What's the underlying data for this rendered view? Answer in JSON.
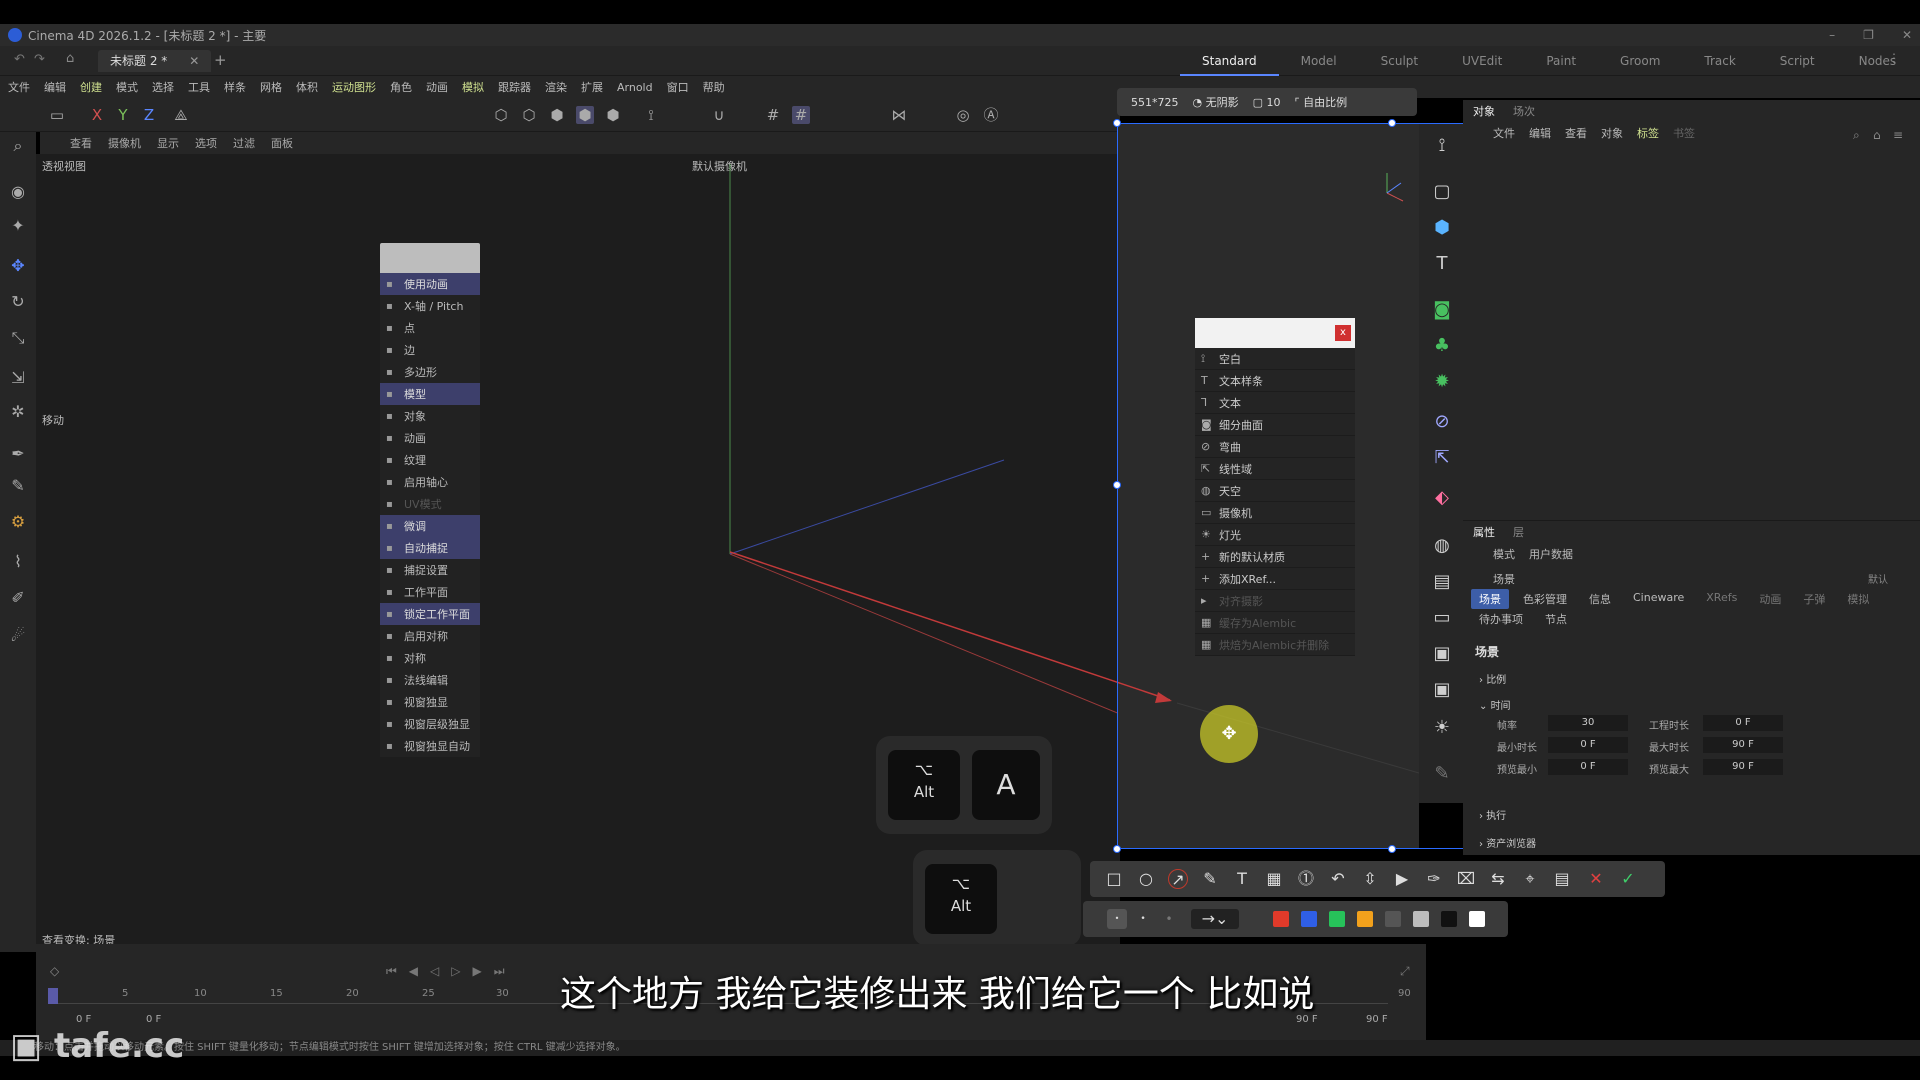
{
  "window": {
    "title": "Cinema 4D 2026.1.2 - [未标题 2 *] - 主要",
    "doc_tab": "未标题 2 *",
    "controls": [
      "–",
      "❐",
      "✕"
    ]
  },
  "layouts": [
    "Standard",
    "Model",
    "Sculpt",
    "UVEdit",
    "Paint",
    "Groom",
    "Track",
    "Script",
    "Nodes"
  ],
  "menu": [
    "文件",
    "编辑",
    "创建",
    "模式",
    "选择",
    "工具",
    "样条",
    "网格",
    "体积",
    "运动图形",
    "角色",
    "动画",
    "模拟",
    "跟踪器",
    "渲染",
    "扩展",
    "Arnold",
    "窗口",
    "帮助"
  ],
  "toolbar": {
    "axes": [
      "X",
      "Y",
      "Z"
    ]
  },
  "view_menu": [
    "查看",
    "摄像机",
    "显示",
    "选项",
    "过滤",
    "面板"
  ],
  "viewport": {
    "name": "透视视图",
    "camera": "默认摄像机",
    "move_label": "移动",
    "status": "查看变换: 场景"
  },
  "context_menu_left": {
    "items": [
      {
        "label": "使用动画",
        "state": "sel"
      },
      {
        "label": "X-轴 / Pitch",
        "state": ""
      },
      {
        "label": "点",
        "state": ""
      },
      {
        "label": "边",
        "state": ""
      },
      {
        "label": "多边形",
        "state": ""
      },
      {
        "label": "模型",
        "state": "sel"
      },
      {
        "label": "对象",
        "state": ""
      },
      {
        "label": "动画",
        "state": ""
      },
      {
        "label": "纹理",
        "state": ""
      },
      {
        "label": "启用轴心",
        "state": ""
      },
      {
        "label": "UV模式",
        "state": "dim"
      },
      {
        "label": "微调",
        "state": "sel"
      },
      {
        "label": "自动捕捉",
        "state": "sel"
      },
      {
        "label": "捕捉设置",
        "state": ""
      },
      {
        "label": "工作平面",
        "state": ""
      },
      {
        "label": "锁定工作平面",
        "state": "sel"
      },
      {
        "label": "启用对称",
        "state": ""
      },
      {
        "label": "对称",
        "state": ""
      },
      {
        "label": "法线编辑",
        "state": ""
      },
      {
        "label": "视窗独显",
        "state": ""
      },
      {
        "label": "视窗层级独显",
        "state": ""
      },
      {
        "label": "视窗独显自动",
        "state": ""
      }
    ]
  },
  "keys": {
    "alt_symbol": "⌥",
    "alt_label": "Alt",
    "a_label": "A"
  },
  "selection_info": {
    "size": "551*725",
    "shadow": "无阴影",
    "radius": "10",
    "ratio": "自由比例"
  },
  "create_menu": {
    "close": "x",
    "items": [
      {
        "label": "空白",
        "icon": "null-icon",
        "state": ""
      },
      {
        "label": "文本样条",
        "icon": "text-icon",
        "state": ""
      },
      {
        "label": "文本",
        "icon": "text3d-icon",
        "state": ""
      },
      {
        "label": "细分曲面",
        "icon": "subdivision-icon",
        "state": ""
      },
      {
        "label": "弯曲",
        "icon": "bend-icon",
        "state": ""
      },
      {
        "label": "线性域",
        "icon": "field-icon",
        "state": ""
      },
      {
        "label": "天空",
        "icon": "sky-icon",
        "state": ""
      },
      {
        "label": "摄像机",
        "icon": "camera-icon",
        "state": ""
      },
      {
        "label": "灯光",
        "icon": "light-icon",
        "state": ""
      },
      {
        "label": "新的默认材质",
        "icon": "plus-icon",
        "state": ""
      },
      {
        "label": "添加XRef...",
        "icon": "plus-icon",
        "state": ""
      },
      {
        "label": "对齐摄影",
        "icon": "align-icon",
        "state": "dim"
      },
      {
        "label": "缓存为Alembic",
        "icon": "alembic-icon",
        "state": "dim"
      },
      {
        "label": "烘焙为Alembic并删除",
        "icon": "alembic-icon",
        "state": "dim"
      }
    ]
  },
  "object_manager": {
    "tabs": [
      "对象",
      "场次"
    ],
    "menu": [
      "文件",
      "编辑",
      "查看",
      "对象",
      "标签",
      "书签"
    ]
  },
  "attribute_manager": {
    "tabs": [
      "属性",
      "层"
    ],
    "menu": [
      "模式",
      "用户数据"
    ],
    "context": "场景",
    "preset": "默认",
    "chips_row1": [
      "场景",
      "色彩管理",
      "信息",
      "Cineware",
      "XRefs",
      "动画",
      "子弹",
      "模拟"
    ],
    "chips_row2": [
      "待办事项",
      "节点"
    ],
    "section_title": "场景",
    "groups": [
      "比例",
      "时间",
      "执行",
      "资产浏览器"
    ],
    "fields": [
      {
        "label": "帧率",
        "value": "30",
        "label2": "工程时长",
        "value2": "0 F"
      },
      {
        "label": "最小时长",
        "value": "0 F",
        "label2": "最大时长",
        "value2": "90 F"
      },
      {
        "label": "预览最小",
        "value": "0 F",
        "label2": "预览最大",
        "value2": "90 F"
      }
    ]
  },
  "annotation": {
    "colors": [
      "#e03a2a",
      "#2f5fe6",
      "#27c25a",
      "#f2a11c",
      "#555555",
      "#bdbdbd",
      "#111111",
      "#ffffff"
    ],
    "cancel": "✕",
    "confirm": "✓"
  },
  "timeline": {
    "ticks": [
      "0",
      "5",
      "10",
      "15",
      "20",
      "25",
      "30",
      "90"
    ],
    "start": "0 F",
    "current": "0 F",
    "end": "90 F",
    "end2": "90 F"
  },
  "status_bar": "移动：点击并拖动以移动元素。按住 SHIFT 键量化移动；节点编辑模式时按住 SHIFT 键增加选择对象；按住 CTRL 键减少选择对象。",
  "subtitle": "这个地方 我给它装修出来 我们给它一个 比如说",
  "watermark": "tafe.cc"
}
